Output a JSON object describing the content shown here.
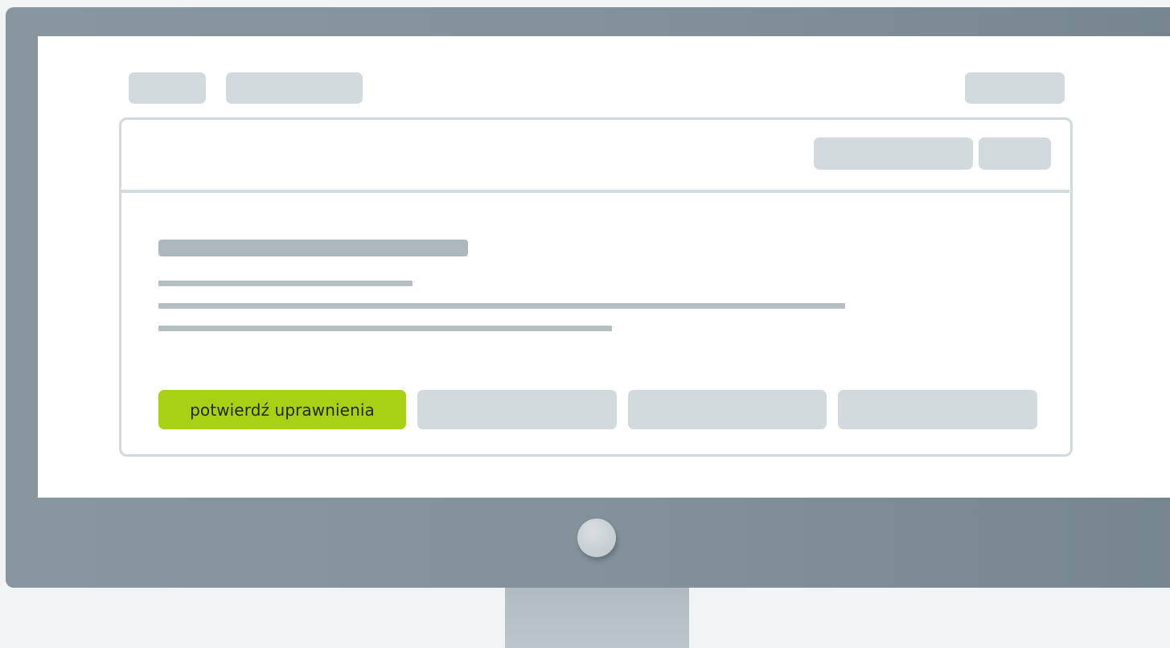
{
  "actions": {
    "primary_label": "potwierdź uprawnienia"
  },
  "colors": {
    "accent": "#a9d114",
    "placeholder": "#d3dadd",
    "monitor_frame": "#83919b",
    "screen": "#ffffff"
  }
}
